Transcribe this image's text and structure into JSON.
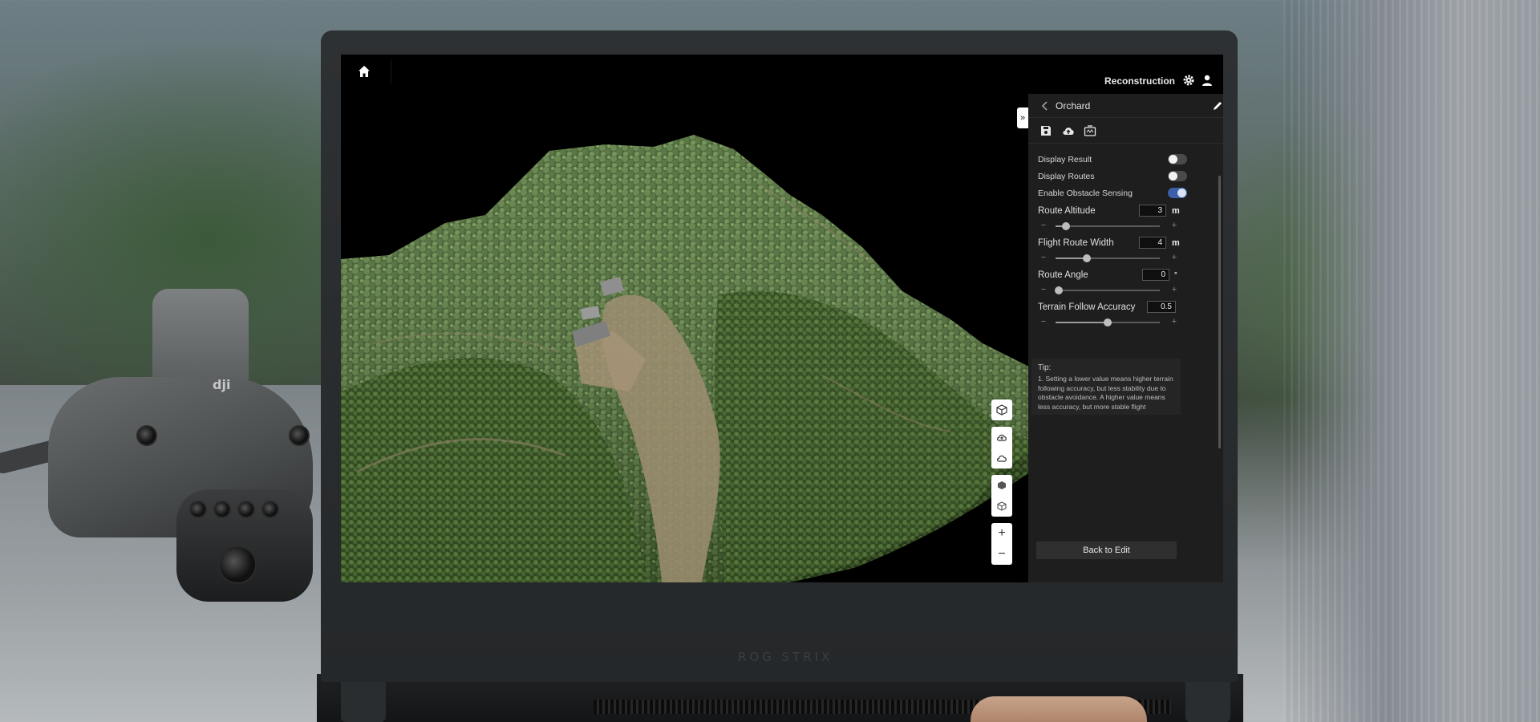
{
  "app": {
    "header_title": "Reconstruction"
  },
  "panel": {
    "title": "Orchard",
    "toggles": [
      {
        "label": "Display Result",
        "on": false
      },
      {
        "label": "Display Routes",
        "on": false
      },
      {
        "label": "Enable Obstacle Sensing",
        "on": true
      }
    ],
    "params": [
      {
        "label": "Route Altitude",
        "value": "3",
        "unit": "m",
        "slider_fraction": 0.1
      },
      {
        "label": "Flight Route Width",
        "value": "4",
        "unit": "m",
        "slider_fraction": 0.3
      },
      {
        "label": "Route Angle",
        "value": "0",
        "unit": "°",
        "slider_fraction": 0.03
      },
      {
        "label": "Terrain Follow Accuracy",
        "value": "0.5",
        "unit": "",
        "slider_fraction": 0.5
      }
    ],
    "tip": {
      "title": "Tip:",
      "text": "1. Setting a lower value means higher terrain following accuracy, but less stability due to obstacle avoidance. A higher value means less accuracy, but more stable flight"
    },
    "back_button": "Back to Edit"
  },
  "map_tools": {
    "zoom_in": "+",
    "zoom_out": "−"
  },
  "laptop_brand": "ROG STRIX",
  "drone_logo": "dji",
  "colors": {
    "panel_bg": "#1e1e1e",
    "toggle_on": "#3b5fa8",
    "screen_bg": "#000000"
  }
}
